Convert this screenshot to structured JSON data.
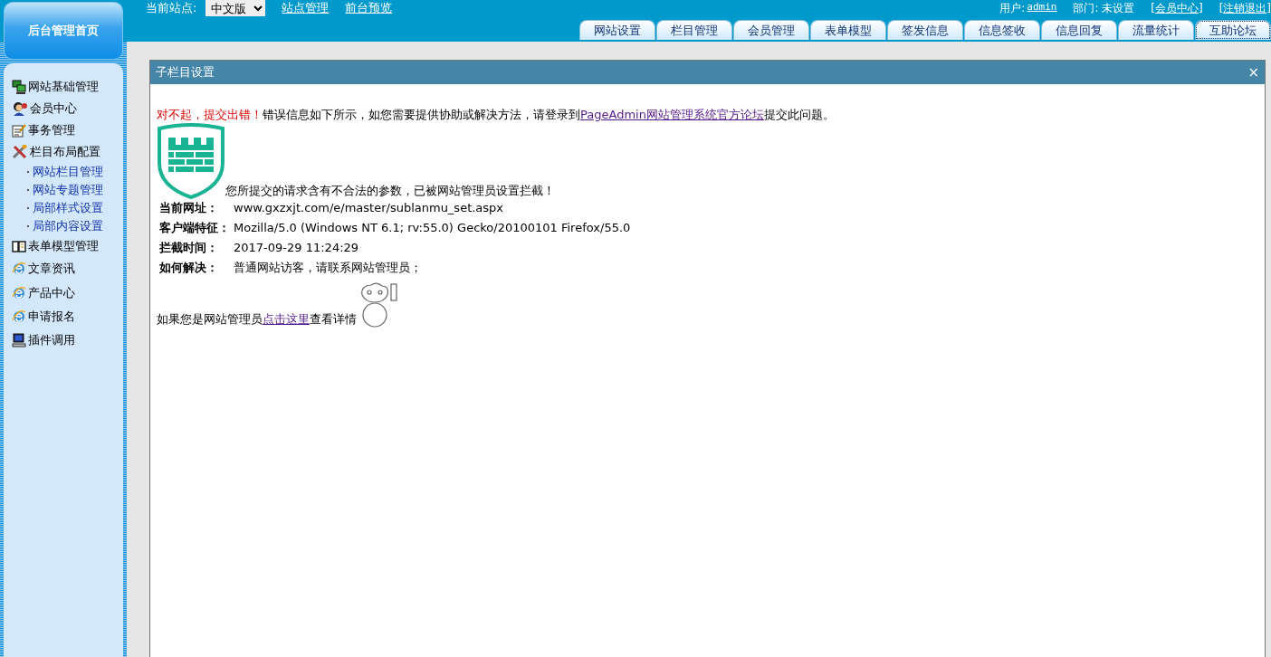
{
  "header": {
    "logo": "后台管理首页",
    "site_label": "当前站点:",
    "site_select": "中文版",
    "links": [
      "站点管理",
      "前台预览"
    ],
    "user_label": "用户:",
    "user": "admin",
    "dept_label": "部门:",
    "dept": "未设置",
    "user_links": [
      "[会员中心]",
      "[注销退出]"
    ],
    "tabs": [
      {
        "label": "网站设置",
        "selected": false
      },
      {
        "label": "栏目管理",
        "selected": false
      },
      {
        "label": "会员管理",
        "selected": false
      },
      {
        "label": "表单模型",
        "selected": false
      },
      {
        "label": "签发信息",
        "selected": false
      },
      {
        "label": "信息签收",
        "selected": false
      },
      {
        "label": "信息回复",
        "selected": false
      },
      {
        "label": "流量统计",
        "selected": false
      },
      {
        "label": "互助论坛",
        "selected": true
      }
    ]
  },
  "sidebar": {
    "items": [
      {
        "label": "网站基础管理"
      },
      {
        "label": "会员中心"
      },
      {
        "label": "事务管理"
      },
      {
        "label": "栏目布局配置",
        "children": [
          {
            "label": "网站栏目管理"
          },
          {
            "label": "网站专题管理"
          },
          {
            "label": "局部样式设置"
          },
          {
            "label": "局部内容设置"
          }
        ]
      },
      {
        "label": "表单模型管理"
      },
      {
        "label": "文章资讯"
      },
      {
        "label": "产品中心"
      },
      {
        "label": "申请报名"
      },
      {
        "label": "插件调用"
      }
    ]
  },
  "dialog": {
    "title": "子栏目设置",
    "close": "×",
    "error_title": "对不起，提交出错！",
    "message_before": "错误信息如下所示，如您需要提供协助或解决方法，请登录到",
    "message_link": "PageAdmin网站管理系统官方论坛",
    "message_after": "提交此问题。",
    "notice": "您所提交的请求含有不合法的参数，已被网站管理员设置拦截！",
    "fields": [
      {
        "label": "当前网址：",
        "value": "www.gxzxjt.com/e/master/sublanmu_set.aspx"
      },
      {
        "label": "客户端特征：",
        "value": "Mozilla/5.0 (Windows NT 6.1; rv:55.0) Gecko/20100101 Firefox/55.0"
      },
      {
        "label": "拦截时间：",
        "value": "2017-09-29 11:24:29"
      },
      {
        "label": "如何解决：",
        "value": "普通网站访客，请联系网站管理员；"
      }
    ],
    "footer_before": "如果您是网站管理员",
    "footer_link": "点击这里",
    "footer_after": "查看详情"
  }
}
